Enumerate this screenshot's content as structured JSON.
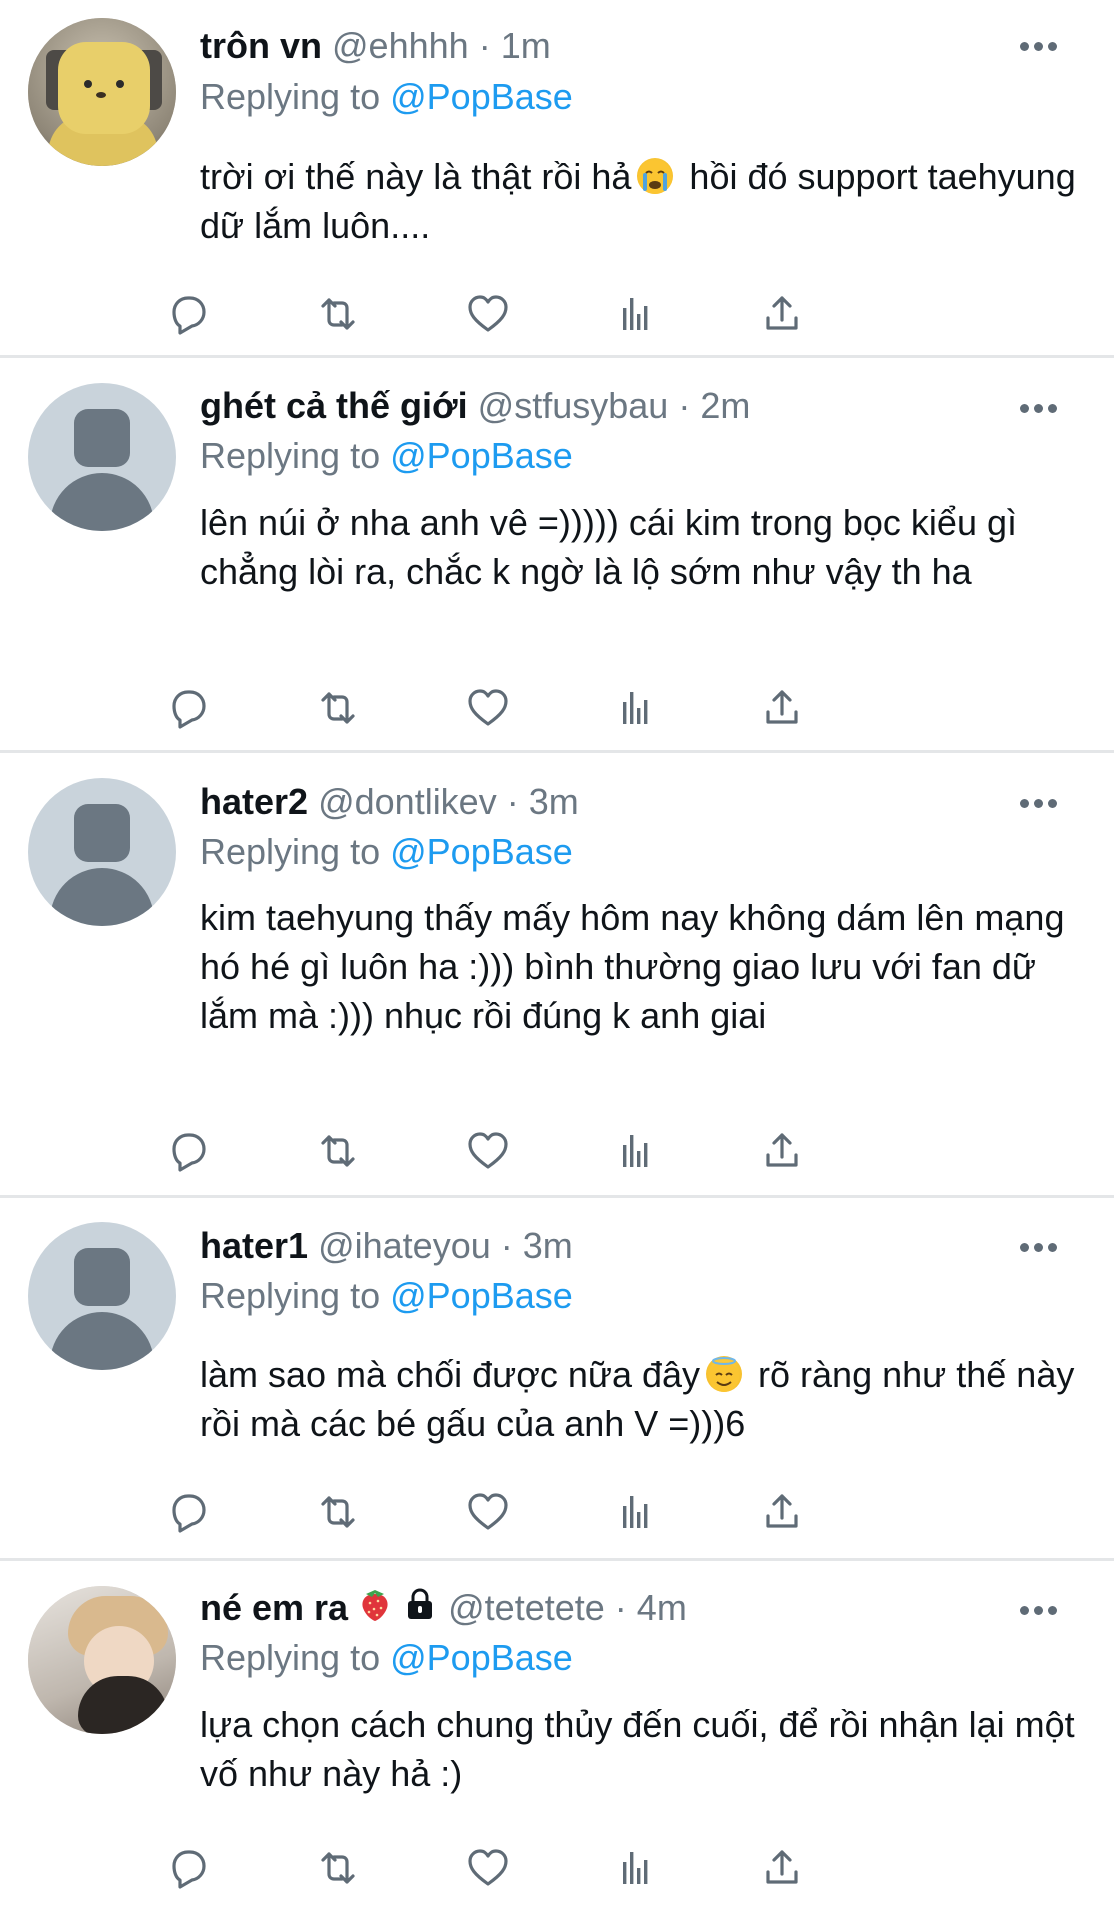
{
  "reply_prefix": "Replying to",
  "reply_mention": "@PopBase",
  "separator": "·",
  "colors": {
    "accent": "#1d9bf0",
    "muted": "#6b7782",
    "text": "#0f1419",
    "divider": "#e4e6e8"
  },
  "tweets": [
    {
      "name": "trôn vn",
      "handle": "@ehhhh",
      "time": "1m",
      "avatar": "bear-plush-photo",
      "text_before": "trời ơi thế này là thật rồi hả",
      "emoji": "crying-face",
      "text_after": " hồi đó support taehyung dữ lắm luôn...."
    },
    {
      "name": "ghét cả thế giới",
      "handle": "@stfusybau",
      "time": "2m",
      "avatar": "default-profile",
      "text": "lên núi ở nha anh vê =))))) cái kim trong bọc kiểu gì chẳng lòi ra, chắc k ngờ là lộ sớm như vậy th ha"
    },
    {
      "name": "hater2",
      "handle": "@dontlikev",
      "time": "3m",
      "avatar": "default-profile",
      "text": "kim taehyung thấy mấy hôm nay không dám lên mạng hó hé gì luôn ha :))) bình thường giao lưu với fan dữ lắm mà :))) nhục rồi đúng k anh giai"
    },
    {
      "name": "hater1",
      "handle": "@ihateyou",
      "time": "3m",
      "avatar": "default-profile",
      "text_before": "làm sao mà chối được nữa đây",
      "emoji": "smiling-face-with-halo",
      "text_after": " rõ ràng như thế này rồi mà các bé gấu của anh V =)))6"
    },
    {
      "name": "né em ra",
      "name_emoji": "strawberry",
      "protected": true,
      "handle": "@tetetete",
      "time": "4m",
      "avatar": "person-with-cat-photo",
      "text": "lựa chọn cách chung thủy đến cuối, để rồi nhận lại một vố như này hả :)"
    }
  ],
  "action_icons": [
    "reply-icon",
    "retweet-icon",
    "like-icon",
    "analytics-icon",
    "share-icon"
  ]
}
